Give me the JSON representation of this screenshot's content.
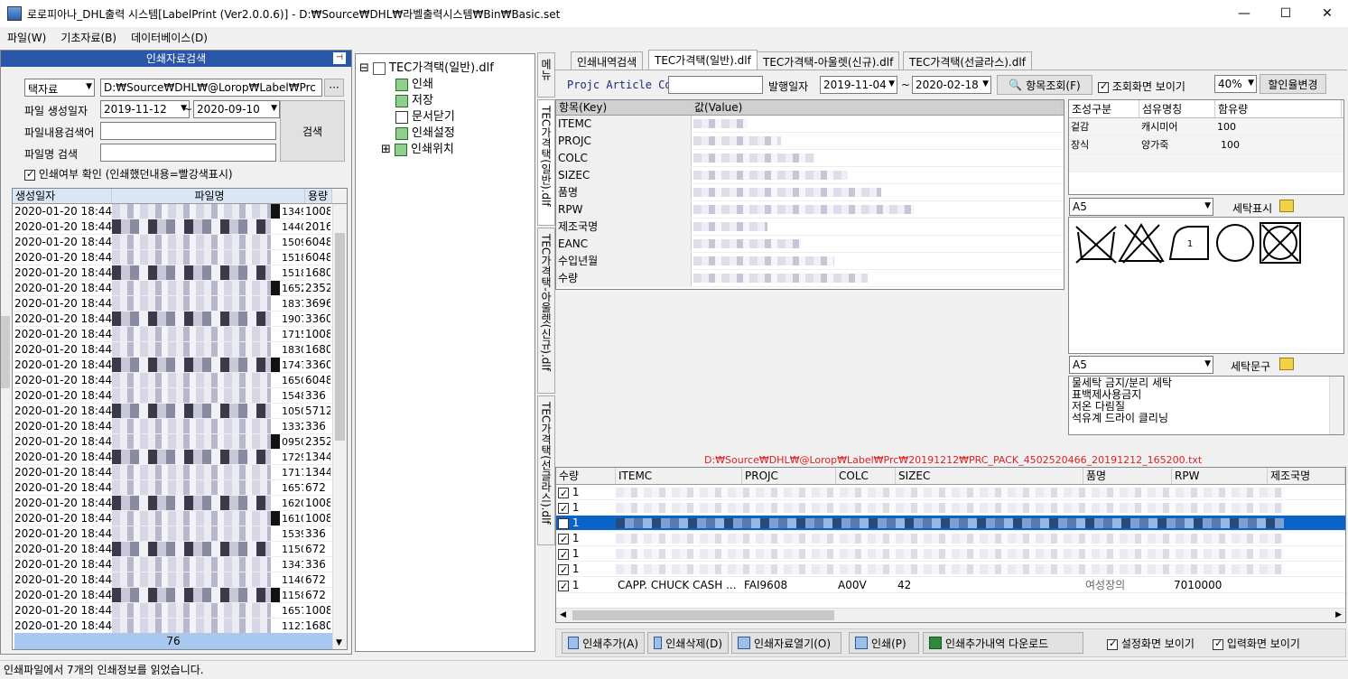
{
  "window": {
    "title": "로로피아나_DHL출력 시스템[LabelPrint (Ver2.0.0.6)] - D:₩Source₩DHL₩라벨출력시스템₩Bin₩Basic.set"
  },
  "menu": [
    "파일(W)",
    "기초자료(B)",
    "데이터베이스(D)"
  ],
  "search_panel": {
    "header": "인쇄자료검색",
    "source_combo": "택자료",
    "path": "D:₩Source₩DHL₩@Lorop₩Label₩Prc",
    "path_btn": "···",
    "date_label": "파일 생성일자",
    "date_from": "2019-11-12",
    "tilde": "~",
    "date_to": "2020-09-10",
    "content_label": "파일내용검색어",
    "filename_label": "파일명 검색",
    "search_btn": "검색",
    "print_check_label": "인쇄여부 확인 (인쇄했던내용=빨강색표시)",
    "columns": [
      "생성일자",
      "파일명",
      "용량"
    ],
    "rows": [
      {
        "date": "2020-01-20 18:44:2",
        "qty": "1349",
        "size": "1008"
      },
      {
        "date": "2020-01-20 18:44:2",
        "qty": "1440",
        "size": "2016"
      },
      {
        "date": "2020-01-20 18:44:2",
        "qty": "1509",
        "size": "6048"
      },
      {
        "date": "2020-01-20 18:44:2",
        "qty": "1518",
        "size": "6048"
      },
      {
        "date": "2020-01-20 18:44:2",
        "qty": "1518",
        "size": "1680"
      },
      {
        "date": "2020-01-20 18:44:2",
        "qty": "1652",
        "size": "2352"
      },
      {
        "date": "2020-01-20 18:44:2",
        "qty": "1837",
        "size": "3696"
      },
      {
        "date": "2020-01-20 18:44:2",
        "qty": "1907",
        "size": "3360"
      },
      {
        "date": "2020-01-20 18:44:2",
        "qty": "1715",
        "size": "1008"
      },
      {
        "date": "2020-01-20 18:44:2",
        "qty": "1830",
        "size": "1680"
      },
      {
        "date": "2020-01-20 18:44:2",
        "qty": "1747",
        "size": "3360"
      },
      {
        "date": "2020-01-20 18:44:2",
        "qty": "1650",
        "size": "6048"
      },
      {
        "date": "2020-01-20 18:44:2",
        "qty": "1548",
        "size": "336"
      },
      {
        "date": "2020-01-20 18:44:2",
        "qty": "1050",
        "size": "5712"
      },
      {
        "date": "2020-01-20 18:44:2",
        "qty": "1332",
        "size": "336"
      },
      {
        "date": "2020-01-20 18:44:2",
        "qty": "0950",
        "size": "2352"
      },
      {
        "date": "2020-01-20 18:44:2",
        "qty": "1729",
        "size": "1344"
      },
      {
        "date": "2020-01-20 18:44:2",
        "qty": "1717",
        "size": "1344"
      },
      {
        "date": "2020-01-20 18:44:2",
        "qty": "1657",
        "size": "672"
      },
      {
        "date": "2020-01-20 18:44:2",
        "qty": "1620",
        "size": "1008"
      },
      {
        "date": "2020-01-20 18:44:2",
        "qty": "1610",
        "size": "1008"
      },
      {
        "date": "2020-01-20 18:44:2",
        "qty": "1539",
        "size": "336"
      },
      {
        "date": "2020-01-20 18:44:2",
        "qty": "1150",
        "size": "672"
      },
      {
        "date": "2020-01-20 18:44:2",
        "qty": "1341",
        "size": "336"
      },
      {
        "date": "2020-01-20 18:44:2",
        "qty": "1140",
        "size": "672"
      },
      {
        "date": "2020-01-20 18:44:2",
        "qty": "1158",
        "size": "672"
      },
      {
        "date": "2020-01-20 18:44:2",
        "qty": "1657",
        "size": "1008"
      },
      {
        "date": "2020-01-20 18:44:2",
        "qty": "1121",
        "size": "1680"
      }
    ],
    "footer_count": "76"
  },
  "tree": {
    "root": "TEC가격택(일반).dlf",
    "items": [
      "인쇄",
      "저장",
      "문서닫기",
      "인쇄설정",
      "인쇄위치"
    ]
  },
  "side_tabs": [
    "메뉴",
    "TEC가격택(일반).dlf",
    "TEC가격택-아울렛(신규).dlf",
    "TEC가격택(선글라스).dlf"
  ],
  "tabs": [
    "인쇄내역검색",
    "TEC가격택(일반).dlf",
    "TEC가격택-아울렛(신규).dlf",
    "TEC가격택(선글라스).dlf"
  ],
  "toolbar": {
    "article_label": "Projc Article Code",
    "issue_label": "발행일자",
    "date_from": "2019-11-04",
    "tilde": "~",
    "date_to": "2020-02-18",
    "lookup_btn": "항목조회(F)",
    "show_lookup_label": "조회화면 보이기",
    "zoom": "40%",
    "discount_btn": "할인율변경"
  },
  "kv_grid": {
    "columns": [
      "항목(Key)",
      "값(Value)"
    ],
    "keys": [
      "ITEMC",
      "PROJC",
      "COLC",
      "SIZEC",
      "품명",
      "RPW",
      "제조국명",
      "EANC",
      "수입년월",
      "수량"
    ]
  },
  "composition": {
    "columns": [
      "조성구분",
      "섬유명칭",
      "함유량"
    ],
    "rows": [
      [
        "겉감",
        "캐시미어",
        "100"
      ],
      [
        "장식",
        "양가죽",
        "100"
      ]
    ]
  },
  "care_symbols": {
    "combo": "A5",
    "label": "세탁표시"
  },
  "care_text": {
    "combo": "A5",
    "label": "세탁문구",
    "lines": [
      "물세탁 금지/분리 세탁",
      "표백제사용금지",
      "저온 다림질",
      "석유계 드라이 클리닝"
    ]
  },
  "file_path": "D:₩Source₩DHL₩@Lorop₩Label₩Prc₩20191212₩PRC_PACK_4502520466_20191212_165200.txt",
  "print_grid": {
    "columns": [
      "수량",
      "ITEMC",
      "PROJC",
      "COLC",
      "SIZEC",
      "품명",
      "RPW",
      "제조국명"
    ],
    "rows": [
      "1",
      "1",
      "1",
      "1",
      "1",
      "1",
      "1"
    ],
    "last_row": {
      "itemc": "CAPP. CHUCK CASH ...",
      "projc": "FAI9608",
      "colc": "A00V",
      "sizec": "42",
      "name": "여성장의",
      "rpw": "7010000"
    }
  },
  "bottom_buttons": [
    "인쇄추가(A)",
    "인쇄삭제(D)",
    "인쇄자료열기(O)",
    "인쇄(P)",
    "인쇄추가내역 다운로드"
  ],
  "bottom_checks": [
    "설정화면 보이기",
    "입력화면 보이기"
  ],
  "status": "인쇄파일에서 7개의 인쇄정보를 읽었습니다.",
  "colors": {
    "accent": "#2956a8",
    "selection": "#0a64c8",
    "path_red": "#e02020"
  }
}
